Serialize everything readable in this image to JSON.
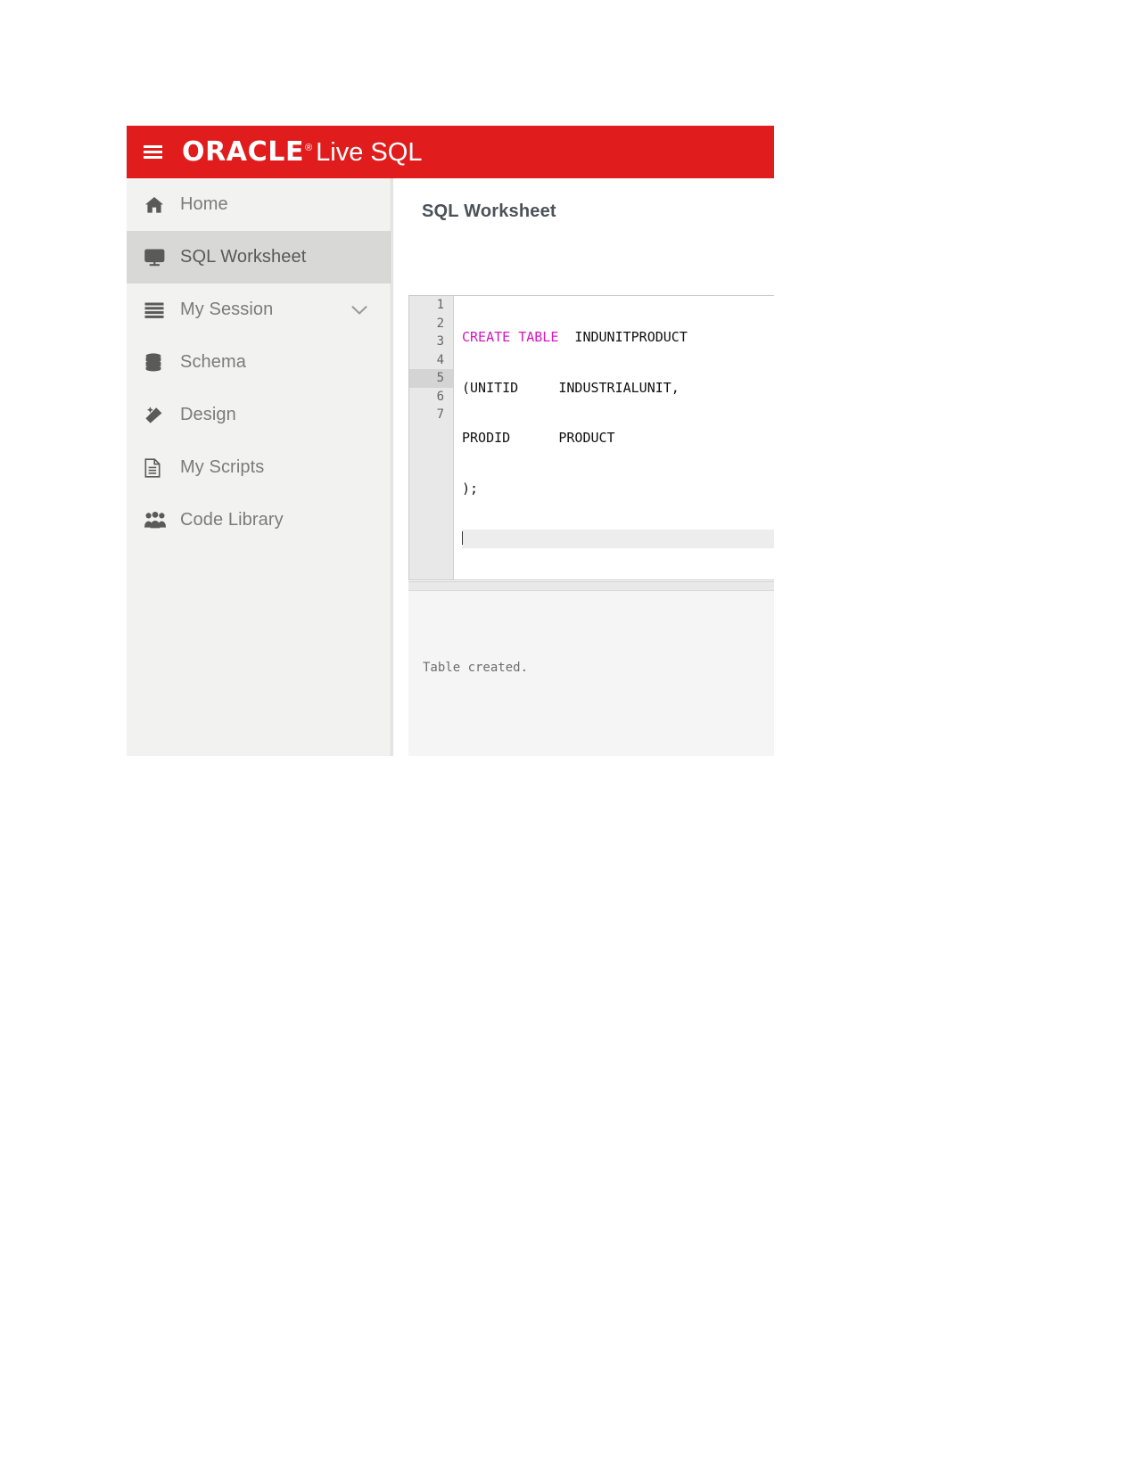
{
  "header": {
    "menu_icon": "hamburger-menu-icon",
    "brand_oracle": "ORACLE",
    "brand_registered": "®",
    "brand_product": "Live SQL",
    "background_color": "#e01c1c"
  },
  "sidebar": {
    "items": [
      {
        "label": "Home",
        "icon": "home-icon",
        "active": false,
        "has_chevron": false
      },
      {
        "label": "SQL Worksheet",
        "icon": "monitor-icon",
        "active": true,
        "has_chevron": false
      },
      {
        "label": "My Session",
        "icon": "list-lines-icon",
        "active": false,
        "has_chevron": true
      },
      {
        "label": "Schema",
        "icon": "database-icon",
        "active": false,
        "has_chevron": false
      },
      {
        "label": "Design",
        "icon": "magic-wand-icon",
        "active": false,
        "has_chevron": false
      },
      {
        "label": "My Scripts",
        "icon": "document-icon",
        "active": false,
        "has_chevron": false
      },
      {
        "label": "Code Library",
        "icon": "users-group-icon",
        "active": false,
        "has_chevron": false
      }
    ]
  },
  "main": {
    "title": "SQL Worksheet",
    "editor": {
      "current_line": 5,
      "gutter_numbers": [
        "1",
        "2",
        "3",
        "4",
        "5",
        "6",
        "7"
      ],
      "lines": [
        {
          "number": "1",
          "keyword": "CREATE TABLE",
          "rest": "  INDUNITPRODUCT"
        },
        {
          "number": "2",
          "keyword": "",
          "rest": "(UNITID     INDUSTRIALUNIT,"
        },
        {
          "number": "3",
          "keyword": "",
          "rest": "PRODID      PRODUCT"
        },
        {
          "number": "4",
          "keyword": "",
          "rest": ");"
        },
        {
          "number": "5",
          "keyword": "",
          "rest": ""
        },
        {
          "number": "6",
          "keyword": "",
          "rest": ""
        },
        {
          "number": "7",
          "keyword": "",
          "rest": ""
        }
      ],
      "keyword_color": "#d617c0"
    },
    "results": {
      "message": "Table created."
    }
  }
}
